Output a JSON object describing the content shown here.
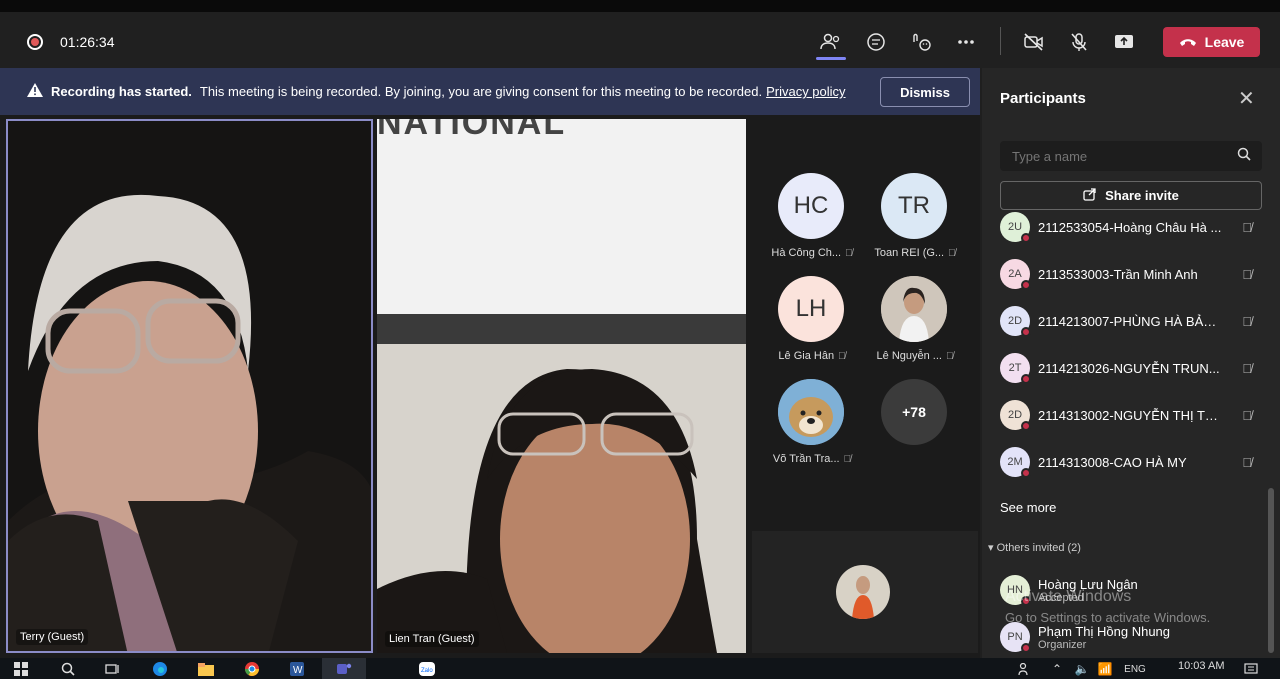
{
  "topbar": {
    "timer": "01:26:34",
    "leave_label": "Leave"
  },
  "banner": {
    "title": "Recording has started.",
    "message": "This meeting is being recorded. By joining, you are giving consent for this meeting to be recorded.",
    "link": "Privacy policy",
    "dismiss_label": "Dismiss"
  },
  "stage": {
    "terry_name": "Terry (Guest)",
    "lien_name": "Lien Tran (Guest)",
    "wall_text": "NATIONAL",
    "avatars": [
      {
        "initials": "HC",
        "name": "Hà Công Ch...",
        "color": "#e8ebfa"
      },
      {
        "initials": "TR",
        "name": "Toan REI (G...",
        "color": "#dbe8f5"
      },
      {
        "initials": "LH",
        "name": "Lê Gia Hân",
        "color": "#fbe3dc"
      },
      {
        "initials": "",
        "name": "Lê Nguyễn ...",
        "color": "#b9a99a"
      },
      {
        "initials": "",
        "name": "Võ Trần Tra...",
        "color": "#6fa0c8"
      }
    ],
    "more_count": "+78"
  },
  "panel": {
    "title": "Participants",
    "search_placeholder": "Type a name",
    "share_label": "Share invite",
    "participants": [
      {
        "initials": "2U",
        "name": "2112533054-Hoàng Châu Hà ...",
        "color": "#dff0d8"
      },
      {
        "initials": "2A",
        "name": "2113533003-Trần Minh Anh",
        "color": "#f7d9e3"
      },
      {
        "initials": "2D",
        "name": "2114213007-PHÙNG HÀ BẢO...",
        "color": "#e1e4f8"
      },
      {
        "initials": "2T",
        "name": "2114213026-NGUYỄN TRUN...",
        "color": "#f2dff0"
      },
      {
        "initials": "2D",
        "name": "2114313002-NGUYỄN THỊ TH...",
        "color": "#efe2d6"
      },
      {
        "initials": "2M",
        "name": "2114313008-CAO HÀ MY",
        "color": "#e3e3f8"
      }
    ],
    "see_more": "See more",
    "others_label": "Others invited (2)",
    "others": [
      {
        "initials": "HN",
        "name": "Hoàng Lưu Ngân",
        "role": "Accepted",
        "color": "#e4efd6"
      },
      {
        "initials": "PN",
        "name": "Phạm Thị Hồng Nhung",
        "role": "Organizer",
        "color": "#e7e3f5"
      }
    ]
  },
  "watermark": {
    "line1": "Activate Windows",
    "line2": "Go to Settings to activate Windows."
  },
  "taskbar": {
    "clock": "10:03 AM",
    "lang": "ENG"
  }
}
